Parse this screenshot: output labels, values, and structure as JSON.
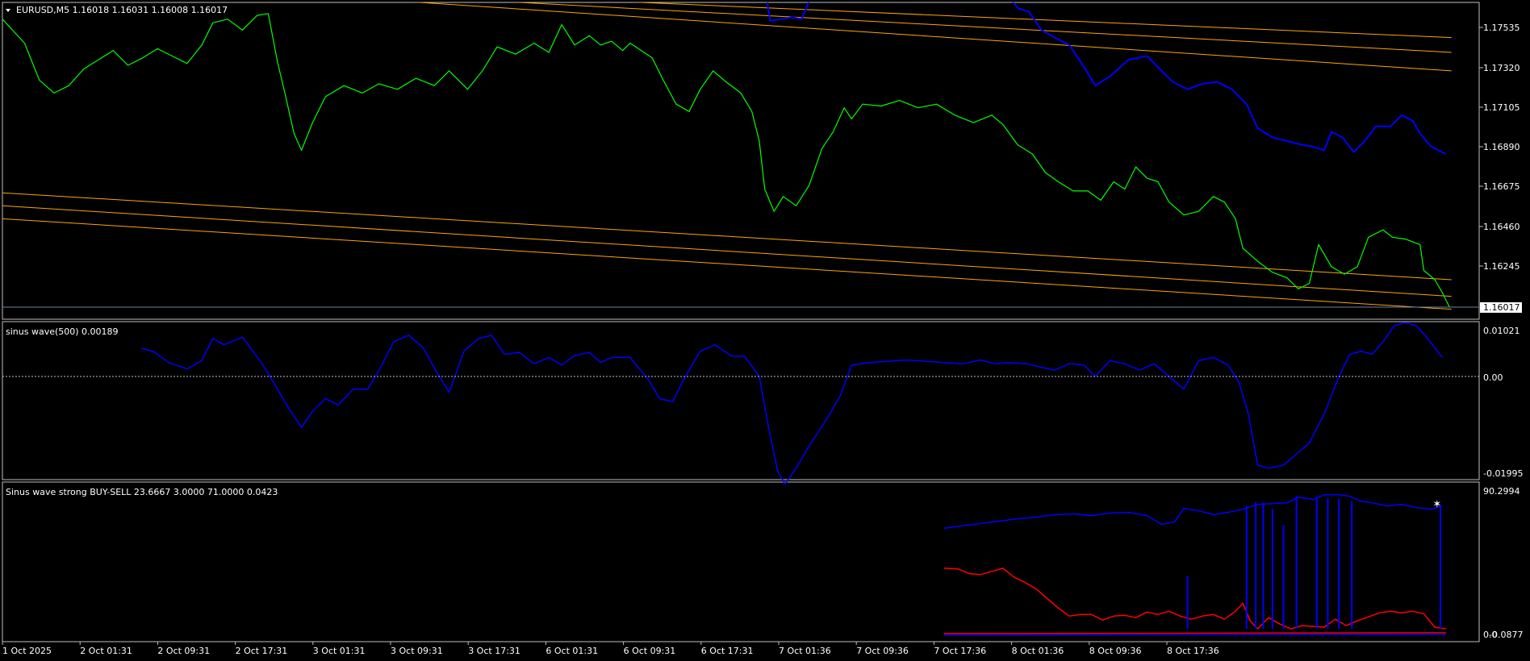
{
  "main": {
    "symbol_label": "EURUSD,M5  1.16018 1.16031 1.16008 1.16017",
    "price_ticks": [
      "1.17535",
      "1.17320",
      "1.17105",
      "1.16890",
      "1.16675",
      "1.16460",
      "1.16245"
    ],
    "current_price": "1.16017",
    "colors": {
      "price": "#00ff00",
      "wave": "#0000ff",
      "channel": "#ffa500",
      "grid": "#c0c0c0",
      "bid_line": "#6f7fa0"
    }
  },
  "indicator1": {
    "label": "sinus wave(500) 0.00189",
    "ticks": [
      "0.01021",
      "0.00",
      "-0.01995"
    ],
    "color": "#0000ff"
  },
  "indicator2": {
    "label": "Sinus wave strong BUY-SELL 23.6667 3.0000 71.0000 0.0423",
    "ticks": [
      "90.2994",
      "0.0",
      "-0.0877"
    ],
    "colors": {
      "strength": "#0000ff",
      "sell": "#ff0000",
      "buy": "#0000ff"
    }
  },
  "time_axis": [
    "1 Oct 2025",
    "2 Oct 01:31",
    "2 Oct 09:31",
    "2 Oct 17:31",
    "3 Oct 01:31",
    "3 Oct 09:31",
    "3 Oct 17:31",
    "6 Oct 01:31",
    "6 Oct 09:31",
    "6 Oct 17:31",
    "7 Oct 01:36",
    "7 Oct 09:36",
    "7 Oct 17:36",
    "8 Oct 01:36",
    "8 Oct 09:36",
    "8 Oct 17:36"
  ],
  "series": {
    "price": [
      [
        0.0,
        1.1758
      ],
      [
        1.2,
        1.1745
      ],
      [
        2.0,
        1.1725
      ],
      [
        2.8,
        1.1718
      ],
      [
        3.6,
        1.1722
      ],
      [
        4.4,
        1.1731
      ],
      [
        5.2,
        1.1736
      ],
      [
        6.0,
        1.1741
      ],
      [
        6.8,
        1.1733
      ],
      [
        7.6,
        1.1737
      ],
      [
        8.4,
        1.1742
      ],
      [
        9.2,
        1.1738
      ],
      [
        10.0,
        1.1734
      ],
      [
        10.8,
        1.1744
      ],
      [
        11.4,
        1.1756
      ],
      [
        12.2,
        1.1758
      ],
      [
        13.0,
        1.1752
      ],
      [
        13.8,
        1.176
      ],
      [
        14.4,
        1.1761
      ],
      [
        14.9,
        1.1735
      ],
      [
        15.3,
        1.1718
      ],
      [
        15.8,
        1.1696
      ],
      [
        16.2,
        1.1687
      ],
      [
        16.8,
        1.1702
      ],
      [
        17.5,
        1.1716
      ],
      [
        18.5,
        1.1722
      ],
      [
        19.5,
        1.1718
      ],
      [
        20.4,
        1.1723
      ],
      [
        21.4,
        1.172
      ],
      [
        22.4,
        1.1726
      ],
      [
        23.4,
        1.1722
      ],
      [
        24.2,
        1.173
      ],
      [
        25.2,
        1.172
      ],
      [
        26.0,
        1.173
      ],
      [
        26.8,
        1.1743
      ],
      [
        27.8,
        1.1739
      ],
      [
        28.8,
        1.1745
      ],
      [
        29.6,
        1.174
      ],
      [
        30.3,
        1.1755
      ],
      [
        31.0,
        1.1744
      ],
      [
        31.8,
        1.1749
      ],
      [
        32.4,
        1.1744
      ],
      [
        33.0,
        1.1746
      ],
      [
        33.6,
        1.1741
      ],
      [
        34.0,
        1.1745
      ],
      [
        35.2,
        1.1737
      ],
      [
        35.8,
        1.1725
      ],
      [
        36.5,
        1.1712
      ],
      [
        37.2,
        1.1708
      ],
      [
        37.8,
        1.172
      ],
      [
        38.5,
        1.173
      ],
      [
        39.2,
        1.1724
      ],
      [
        40.0,
        1.1718
      ],
      [
        40.6,
        1.1708
      ],
      [
        41.0,
        1.1692
      ],
      [
        41.3,
        1.1666
      ],
      [
        41.8,
        1.1654
      ],
      [
        42.3,
        1.1662
      ],
      [
        43.0,
        1.1657
      ],
      [
        43.7,
        1.1668
      ],
      [
        44.4,
        1.1688
      ],
      [
        45.0,
        1.1697
      ],
      [
        45.6,
        1.171
      ],
      [
        46.0,
        1.1704
      ],
      [
        46.6,
        1.1712
      ],
      [
        47.6,
        1.1711
      ],
      [
        48.6,
        1.1714
      ],
      [
        49.6,
        1.171
      ],
      [
        50.6,
        1.1712
      ],
      [
        51.6,
        1.1706
      ],
      [
        52.6,
        1.1702
      ],
      [
        53.6,
        1.1706
      ],
      [
        54.2,
        1.1701
      ],
      [
        55.0,
        1.169
      ],
      [
        55.8,
        1.1685
      ],
      [
        56.5,
        1.1675
      ],
      [
        57.2,
        1.167
      ],
      [
        58.0,
        1.1665
      ],
      [
        58.8,
        1.1665
      ],
      [
        59.5,
        1.166
      ],
      [
        60.2,
        1.167
      ],
      [
        60.8,
        1.1666
      ],
      [
        61.4,
        1.1678
      ],
      [
        62.0,
        1.1672
      ],
      [
        62.6,
        1.167
      ],
      [
        63.2,
        1.1659
      ],
      [
        64.0,
        1.1652
      ],
      [
        64.8,
        1.1654
      ],
      [
        65.6,
        1.1662
      ],
      [
        66.2,
        1.1659
      ],
      [
        66.8,
        1.165
      ],
      [
        67.2,
        1.1634
      ],
      [
        68.0,
        1.1627
      ],
      [
        68.8,
        1.1621
      ],
      [
        69.6,
        1.1618
      ],
      [
        70.2,
        1.1612
      ],
      [
        70.8,
        1.1615
      ],
      [
        71.3,
        1.1636
      ],
      [
        72.0,
        1.1624
      ],
      [
        72.7,
        1.162
      ],
      [
        73.4,
        1.1624
      ],
      [
        74.0,
        1.164
      ],
      [
        74.8,
        1.1644
      ],
      [
        75.3,
        1.164
      ],
      [
        76.0,
        1.1639
      ],
      [
        76.8,
        1.1636
      ],
      [
        77.0,
        1.1622
      ],
      [
        77.6,
        1.1617
      ],
      [
        78.0,
        1.161
      ],
      [
        78.4,
        1.1602
      ]
    ],
    "wave_overlay": [
      [
        41.2,
        1.178
      ],
      [
        41.6,
        1.1757
      ],
      [
        42.2,
        1.1758
      ],
      [
        42.8,
        1.1759
      ],
      [
        43.3,
        1.1758
      ],
      [
        43.8,
        1.177
      ],
      [
        44.5,
        1.1773
      ],
      [
        45.0,
        1.1781
      ],
      [
        52.2,
        1.1784
      ],
      [
        53.0,
        1.1768
      ],
      [
        53.6,
        1.1777
      ],
      [
        54.2,
        1.1774
      ],
      [
        55.0,
        1.1764
      ],
      [
        55.6,
        1.1762
      ],
      [
        56.3,
        1.1752
      ],
      [
        57.0,
        1.1748
      ],
      [
        57.8,
        1.1744
      ],
      [
        58.6,
        1.1732
      ],
      [
        59.2,
        1.1722
      ],
      [
        60.0,
        1.1727
      ],
      [
        61.0,
        1.1736
      ],
      [
        62.0,
        1.1738
      ],
      [
        62.8,
        1.173
      ],
      [
        63.4,
        1.1724
      ],
      [
        64.2,
        1.172
      ],
      [
        65.0,
        1.1723
      ],
      [
        65.8,
        1.1724
      ],
      [
        66.6,
        1.172
      ],
      [
        67.4,
        1.1712
      ],
      [
        68.0,
        1.1699
      ],
      [
        68.8,
        1.1694
      ],
      [
        69.6,
        1.1692
      ],
      [
        70.4,
        1.169
      ],
      [
        71.0,
        1.1689
      ],
      [
        71.6,
        1.1687
      ],
      [
        72.0,
        1.1697
      ],
      [
        72.6,
        1.1694
      ],
      [
        73.2,
        1.1686
      ],
      [
        73.8,
        1.1692
      ],
      [
        74.4,
        1.17
      ],
      [
        75.2,
        1.17
      ],
      [
        75.8,
        1.1706
      ],
      [
        76.4,
        1.1703
      ],
      [
        76.8,
        1.1696
      ],
      [
        77.4,
        1.1689
      ],
      [
        78.2,
        1.1685
      ]
    ],
    "sinus": [
      [
        7.5,
        0.0045
      ],
      [
        8.2,
        0.0039
      ],
      [
        9.0,
        0.0022
      ],
      [
        10.0,
        0.0012
      ],
      [
        10.8,
        0.0025
      ],
      [
        11.4,
        0.006
      ],
      [
        12.0,
        0.005
      ],
      [
        13.0,
        0.0062
      ],
      [
        14.0,
        0.0023
      ],
      [
        14.8,
        -0.0015
      ],
      [
        15.5,
        -0.005
      ],
      [
        16.2,
        -0.008
      ],
      [
        16.8,
        -0.0055
      ],
      [
        17.5,
        -0.0035
      ],
      [
        18.2,
        -0.0045
      ],
      [
        19.0,
        -0.002
      ],
      [
        19.8,
        -0.002
      ],
      [
        20.5,
        0.0015
      ],
      [
        21.2,
        0.0055
      ],
      [
        22.0,
        0.0065
      ],
      [
        22.8,
        0.0045
      ],
      [
        23.5,
        0.0008
      ],
      [
        24.2,
        -0.0025
      ],
      [
        25.0,
        0.004
      ],
      [
        25.8,
        0.006
      ],
      [
        26.5,
        0.0065
      ],
      [
        27.2,
        0.0035
      ],
      [
        28.0,
        0.0038
      ],
      [
        28.8,
        0.002
      ],
      [
        29.6,
        0.003
      ],
      [
        30.3,
        0.0018
      ],
      [
        31.0,
        0.0033
      ],
      [
        31.8,
        0.0038
      ],
      [
        32.4,
        0.0022
      ],
      [
        33.0,
        0.003
      ],
      [
        34.0,
        0.003
      ],
      [
        35.0,
        -0.0005
      ],
      [
        35.6,
        -0.0035
      ],
      [
        36.3,
        -0.004
      ],
      [
        37.0,
        0.0
      ],
      [
        37.8,
        0.004
      ],
      [
        38.6,
        0.005
      ],
      [
        39.5,
        0.0032
      ],
      [
        40.2,
        0.0032
      ],
      [
        41.0,
        0.0
      ],
      [
        41.5,
        -0.008
      ],
      [
        42.0,
        -0.015
      ],
      [
        42.4,
        -0.017
      ],
      [
        43.0,
        -0.0145
      ],
      [
        43.8,
        -0.0105
      ],
      [
        44.6,
        -0.007
      ],
      [
        45.4,
        -0.003
      ],
      [
        46.0,
        0.0018
      ],
      [
        47.0,
        0.0022
      ],
      [
        48.0,
        0.0024
      ],
      [
        49.0,
        0.0026
      ],
      [
        50.0,
        0.0024
      ],
      [
        51.0,
        0.0022
      ],
      [
        52.0,
        0.002
      ],
      [
        53.0,
        0.0026
      ],
      [
        53.8,
        0.002
      ],
      [
        54.5,
        0.0022
      ],
      [
        55.5,
        0.002
      ],
      [
        56.2,
        0.0015
      ],
      [
        57.0,
        0.001
      ],
      [
        57.8,
        0.002
      ],
      [
        58.6,
        0.0018
      ],
      [
        59.2,
        0.0
      ],
      [
        60.0,
        0.0025
      ],
      [
        60.8,
        0.002
      ],
      [
        61.6,
        0.001
      ],
      [
        62.4,
        0.002
      ],
      [
        63.2,
        0.0
      ],
      [
        64.0,
        -0.002
      ],
      [
        64.8,
        0.0025
      ],
      [
        65.6,
        0.003
      ],
      [
        66.4,
        0.0018
      ],
      [
        67.0,
        -0.001
      ],
      [
        67.5,
        -0.006
      ],
      [
        68.0,
        -0.014
      ],
      [
        68.6,
        -0.0145
      ],
      [
        69.4,
        -0.014
      ],
      [
        70.2,
        -0.012
      ],
      [
        70.8,
        -0.0105
      ],
      [
        71.6,
        -0.006
      ],
      [
        72.4,
        0.0
      ],
      [
        73.0,
        0.0035
      ],
      [
        73.6,
        0.004
      ],
      [
        74.2,
        0.0035
      ],
      [
        74.8,
        0.0055
      ],
      [
        75.4,
        0.008
      ],
      [
        76.0,
        0.0085
      ],
      [
        76.6,
        0.008
      ],
      [
        77.2,
        0.006
      ],
      [
        78.0,
        0.003
      ]
    ],
    "strength": [
      [
        51.0,
        68.0
      ],
      [
        52.0,
        69.5
      ],
      [
        53.0,
        71.0
      ],
      [
        54.0,
        72.5
      ],
      [
        55.0,
        74.0
      ],
      [
        56.0,
        75.0
      ],
      [
        57.0,
        76.5
      ],
      [
        58.0,
        77.0
      ],
      [
        59.0,
        76.0
      ],
      [
        60.0,
        77.5
      ],
      [
        61.0,
        78.0
      ],
      [
        62.0,
        76.0
      ],
      [
        62.8,
        70.5
      ],
      [
        63.5,
        72.0
      ],
      [
        64.0,
        80.5
      ],
      [
        64.8,
        79.0
      ],
      [
        65.6,
        76.5
      ],
      [
        66.4,
        78.0
      ],
      [
        67.2,
        80.0
      ],
      [
        68.0,
        83.0
      ],
      [
        68.8,
        83.5
      ],
      [
        69.6,
        84.0
      ],
      [
        70.2,
        87.5
      ],
      [
        71.0,
        86.0
      ],
      [
        71.6,
        89.0
      ],
      [
        72.4,
        89.0
      ],
      [
        73.0,
        88.0
      ],
      [
        73.6,
        85.0
      ],
      [
        74.2,
        84.0
      ],
      [
        75.0,
        82.0
      ],
      [
        75.8,
        83.0
      ],
      [
        76.6,
        81.0
      ],
      [
        77.4,
        80.0
      ],
      [
        78.0,
        82.0
      ]
    ],
    "sell": [
      [
        51.0,
        43.0
      ],
      [
        51.8,
        42.5
      ],
      [
        52.4,
        39.5
      ],
      [
        53.0,
        39.0
      ],
      [
        53.6,
        41.0
      ],
      [
        54.2,
        43.0
      ],
      [
        54.8,
        37.5
      ],
      [
        55.4,
        34.0
      ],
      [
        56.0,
        30.0
      ],
      [
        56.6,
        24.0
      ],
      [
        57.2,
        18.0
      ],
      [
        57.8,
        13.0
      ],
      [
        58.4,
        14.0
      ],
      [
        59.0,
        14.0
      ],
      [
        59.6,
        10.5
      ],
      [
        60.2,
        13.0
      ],
      [
        60.8,
        13.5
      ],
      [
        61.4,
        12.0
      ],
      [
        62.0,
        15.5
      ],
      [
        62.6,
        14.0
      ],
      [
        63.2,
        16.0
      ],
      [
        63.8,
        13.0
      ],
      [
        64.4,
        11.0
      ],
      [
        65.0,
        13.0
      ],
      [
        65.6,
        14.0
      ],
      [
        66.2,
        11.0
      ],
      [
        66.8,
        16.0
      ],
      [
        67.2,
        21.0
      ],
      [
        67.6,
        10.0
      ],
      [
        68.0,
        5.0
      ],
      [
        68.6,
        12.0
      ],
      [
        69.2,
        8.0
      ],
      [
        69.8,
        5.0
      ],
      [
        70.4,
        7.0
      ],
      [
        71.0,
        6.5
      ],
      [
        71.6,
        6.0
      ],
      [
        72.2,
        11.0
      ],
      [
        72.8,
        7.0
      ],
      [
        73.4,
        10.0
      ],
      [
        74.0,
        12.5
      ],
      [
        74.6,
        15.0
      ],
      [
        75.2,
        16.0
      ],
      [
        75.8,
        15.0
      ],
      [
        76.4,
        16.0
      ],
      [
        77.0,
        14.5
      ],
      [
        77.6,
        6.0
      ],
      [
        78.2,
        5.0
      ]
    ],
    "buy_spikes": [
      [
        64.2,
        38.0
      ],
      [
        67.4,
        82.0
      ],
      [
        67.9,
        84.5
      ],
      [
        68.3,
        84.0
      ],
      [
        68.8,
        80.0
      ],
      [
        69.4,
        70.0
      ],
      [
        70.1,
        88.0
      ],
      [
        71.2,
        87.5
      ],
      [
        71.8,
        87.0
      ],
      [
        72.4,
        86.5
      ],
      [
        73.1,
        85.0
      ],
      [
        77.9,
        82.5
      ]
    ],
    "markers": [
      [
        77.7,
        83.5
      ]
    ]
  }
}
